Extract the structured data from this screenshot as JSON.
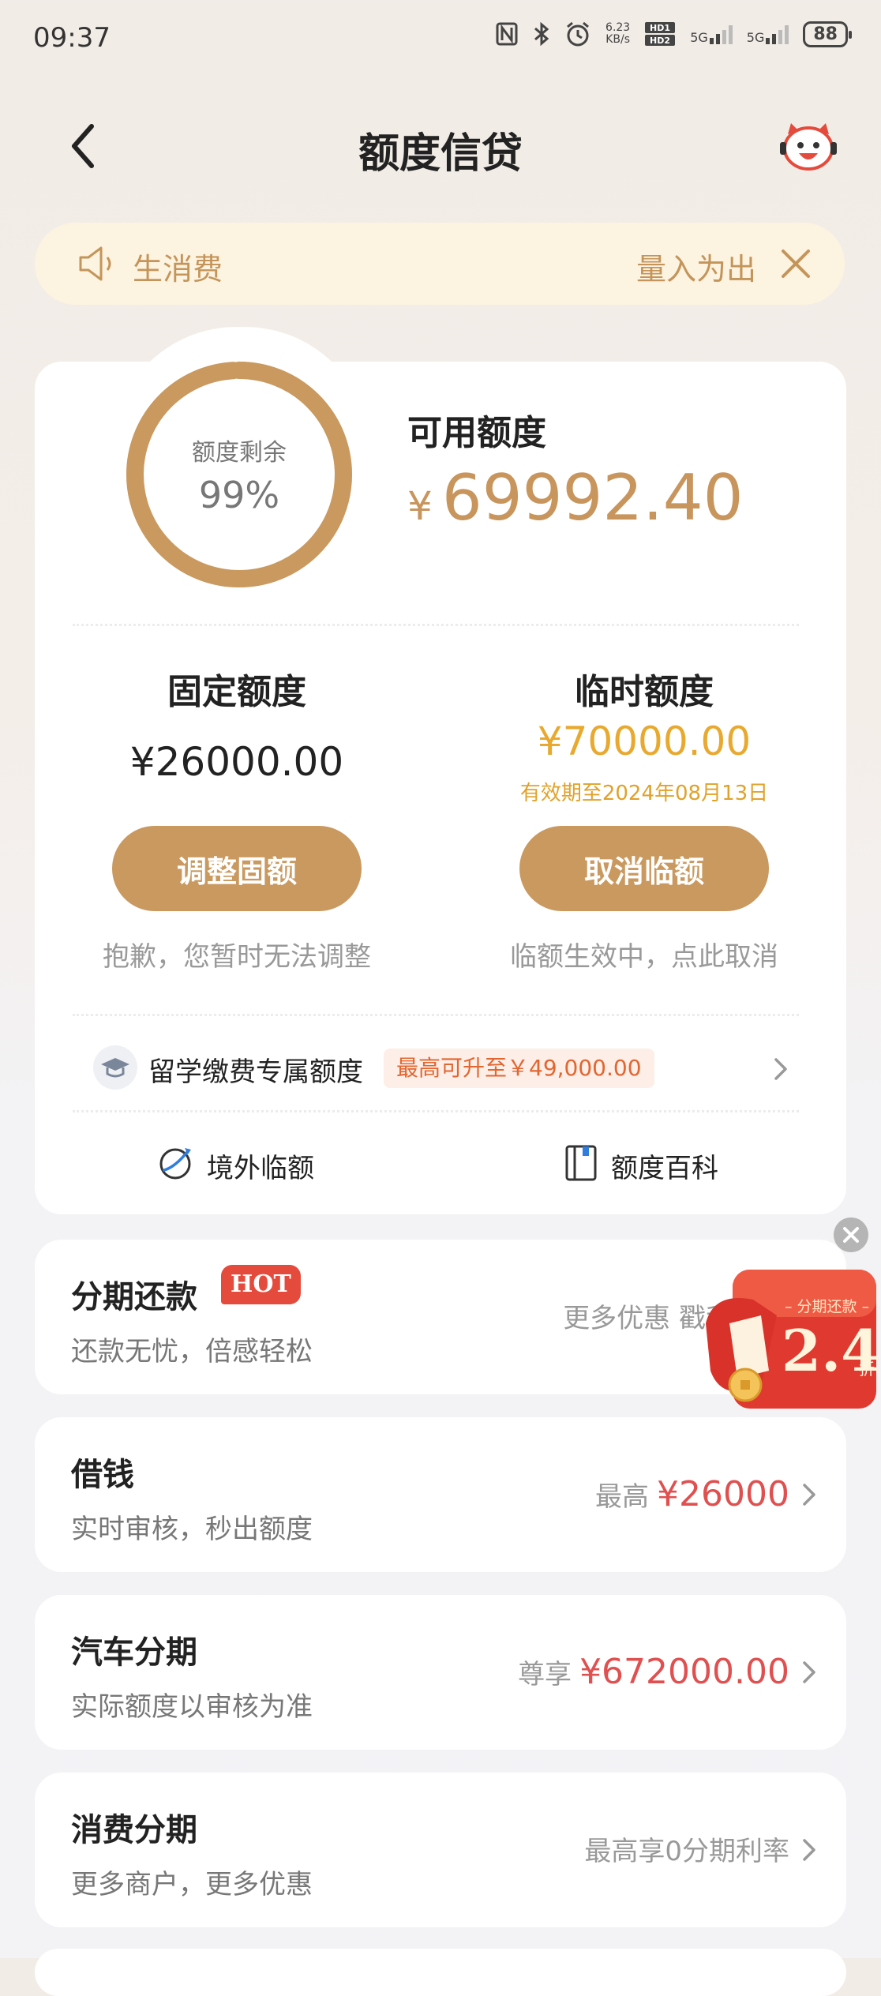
{
  "status_bar": {
    "time": "09:37",
    "net_speed": "6.23\nKB/s",
    "hd_label": "HD1 HD2",
    "net1": "5G",
    "net2": "5G",
    "battery": "88"
  },
  "header": {
    "title": "额度信贷",
    "back_icon": "chevron-left-icon",
    "mascot_icon": "mascot-service-icon"
  },
  "notice": {
    "text": "生消费",
    "right_text": "量入为出",
    "icon": "speaker-icon",
    "close_icon": "close-icon"
  },
  "credit": {
    "ring_label": "额度剩余",
    "ring_percent": "99%",
    "ring_fraction": 0.99,
    "available_label": "可用额度",
    "available_currency": "¥",
    "available_amount": "69992.40",
    "fixed_title": "固定额度",
    "fixed_amount": "¥26000.00",
    "temp_title": "临时额度",
    "temp_amount": "¥70000.00",
    "temp_valid": "有效期至2024年08月13日",
    "adjust_button": "调整固额",
    "cancel_button": "取消临额",
    "fixed_hint": "抱歉，您暂时无法调整",
    "temp_hint": "临额生效中，点此取消",
    "study_label": "留学缴费专属额度",
    "study_tag": "最高可升至￥49,000.00",
    "overseas_label": "境外临额",
    "wiki_label": "额度百科"
  },
  "list": [
    {
      "title": "分期还款",
      "badge": "HOT",
      "subtitle": "还款无忧，倍感轻松",
      "right": "更多优惠 戳我参"
    },
    {
      "title": "借钱",
      "subtitle": "实时审核，秒出额度",
      "right_prefix": "最高",
      "right_amount": "¥26000"
    },
    {
      "title": "汽车分期",
      "subtitle": "实际额度以审核为准",
      "right_prefix": "尊享",
      "right_amount": "¥672000.00"
    },
    {
      "title": "消费分期",
      "subtitle": "更多商户，更多优惠",
      "right": "最高享0分期利率"
    }
  ],
  "promo": {
    "label": "– 分期还款 –",
    "number": "2.4",
    "unit": "折"
  },
  "colors": {
    "gold": "#c9995f",
    "temp_amount": "#e8a92e",
    "red": "#e05050",
    "notice_bg": "#fdf3e1"
  }
}
